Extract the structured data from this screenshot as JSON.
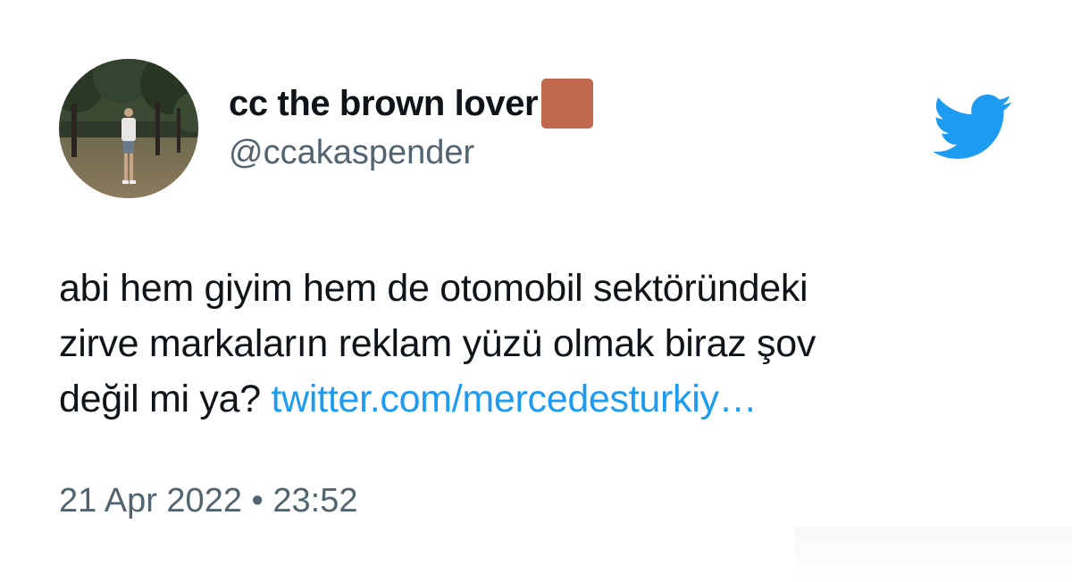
{
  "tweet": {
    "display_name": "cc the brown lover",
    "name_emoji": "brown-square-emoji",
    "handle": "@ccakaspender",
    "text_lines": [
      "abi hem giyim hem de otomobil sektöründeki",
      "zirve markaların reklam yüzü olmak biraz şov",
      "değil mi ya?"
    ],
    "link_text": "twitter.com/mercedesturkiy…",
    "timestamp": "21 Apr 2022 • 23:52"
  },
  "icons": {
    "brand": "twitter-bird-icon",
    "avatar": "profile-photo"
  },
  "colors": {
    "text": "#0f1419",
    "secondary": "#536471",
    "link": "#1d9bf0",
    "brand": "#1d9bf0",
    "brown_square": "#c1694f"
  }
}
